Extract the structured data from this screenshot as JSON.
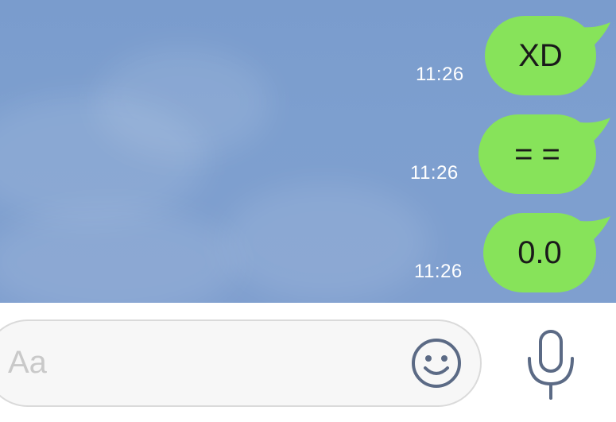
{
  "messages": [
    {
      "text": "XD",
      "time": "11:26"
    },
    {
      "text": "= =",
      "time": "11:26"
    },
    {
      "text": "0.0",
      "time": "11:26"
    }
  ],
  "input": {
    "placeholder": "Aa"
  },
  "icons": {
    "emoji": "smiley-icon",
    "mic": "microphone-icon"
  },
  "colors": {
    "bubble": "#87e35a",
    "chat_background": "#7d9fcf",
    "icon": "#5b6a85"
  }
}
